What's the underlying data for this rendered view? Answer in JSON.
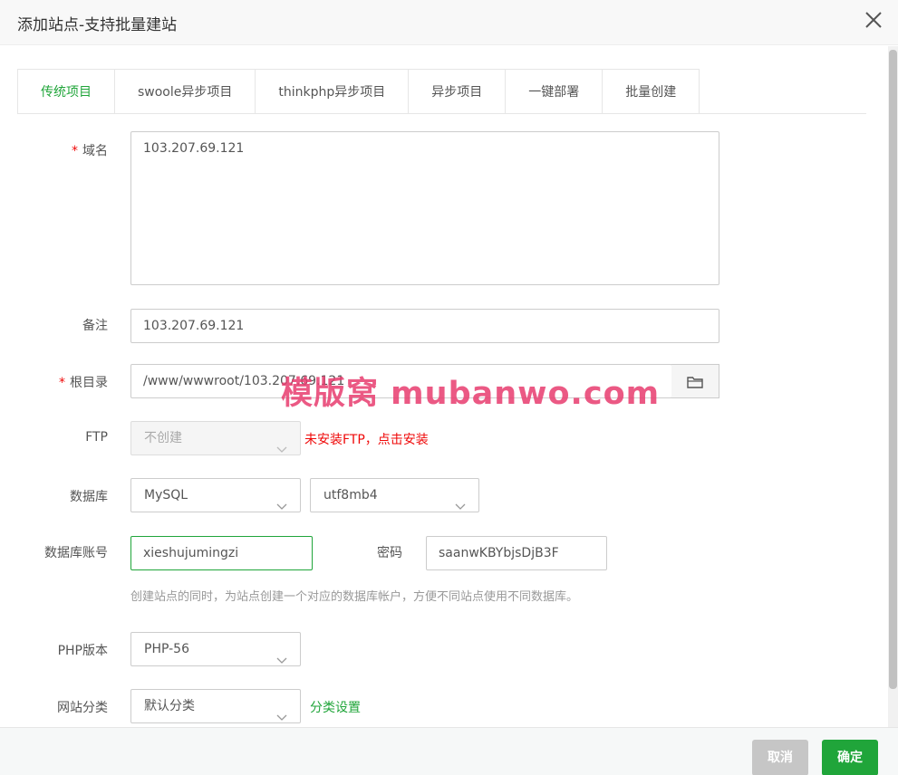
{
  "dialog": {
    "title": "添加站点-支持批量建站"
  },
  "tabs": [
    {
      "label": "传统项目"
    },
    {
      "label": "swoole异步项目"
    },
    {
      "label": "thinkphp异步项目"
    },
    {
      "label": "异步项目"
    },
    {
      "label": "一键部署"
    },
    {
      "label": "批量创建"
    }
  ],
  "form": {
    "domain": {
      "required": "*",
      "label": "域名",
      "value": "103.207.69.121"
    },
    "remark": {
      "label": "备注",
      "value": "103.207.69.121"
    },
    "root": {
      "required": "*",
      "label": "根目录",
      "value": "/www/wwwroot/103.207.69.121"
    },
    "ftp": {
      "label": "FTP",
      "value": "不创建",
      "hint": "未安装FTP，点击安装"
    },
    "database": {
      "label": "数据库",
      "type": "MySQL",
      "charset": "utf8mb4"
    },
    "db_account": {
      "label": "数据库账号",
      "value": "xieshujumingzi",
      "password_label": "密码",
      "password": "saanwKBYbjsDjB3F",
      "hint": "创建站点的同时，为站点创建一个对应的数据库帐户，方便不同站点使用不同数据库。"
    },
    "php": {
      "label": "PHP版本",
      "value": "PHP-56"
    },
    "category": {
      "label": "网站分类",
      "value": "默认分类",
      "link": "分类设置"
    }
  },
  "watermark": "模版窝 mubanwo.com",
  "footer": {
    "cancel": "取消",
    "ok": "确定"
  },
  "colors": {
    "accent": "#20a53a",
    "error": "#ef0808",
    "watermark": "#e83c6e"
  }
}
